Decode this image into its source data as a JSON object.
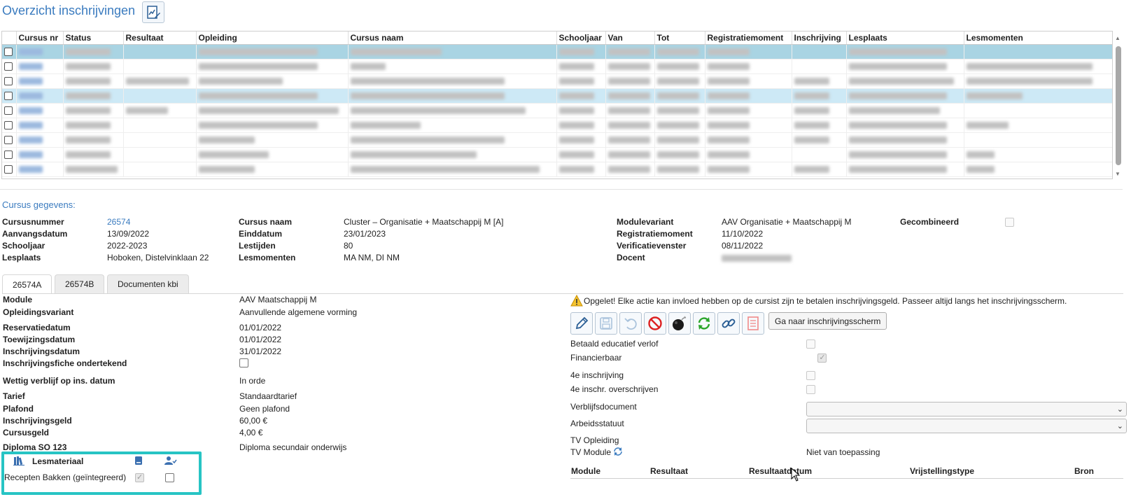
{
  "page": {
    "title": "Overzicht inschrijvingen"
  },
  "grid": {
    "columns": [
      "",
      "Cursus nr",
      "Status",
      "Resultaat",
      "Opleiding",
      "Cursus naam",
      "Schooljaar",
      "Van",
      "Tot",
      "Registratiemoment",
      "Inschrijving",
      "Lesplaats",
      "Lesmomenten"
    ]
  },
  "cursus": {
    "section_title": "Cursus gegevens:",
    "fields": {
      "cursusnummer": {
        "label": "Cursusnummer",
        "value": "26574"
      },
      "aanvangsdatum": {
        "label": "Aanvangsdatum",
        "value": "13/09/2022"
      },
      "schooljaar": {
        "label": "Schooljaar",
        "value": "2022-2023"
      },
      "lesplaats": {
        "label": "Lesplaats",
        "value": "Hoboken, Distelvinklaan 22"
      },
      "cursus_naam": {
        "label": "Cursus naam",
        "value": "Cluster – Organisatie + Maatschappij M [A]"
      },
      "einddatum": {
        "label": "Einddatum",
        "value": "23/01/2023"
      },
      "lestijden": {
        "label": "Lestijden",
        "value": "80"
      },
      "lesmomenten": {
        "label": "Lesmomenten",
        "value": "MA NM, DI NM"
      },
      "modulevariant": {
        "label": "Modulevariant",
        "value": "AAV Organisatie + Maatschappij M"
      },
      "registratiemoment": {
        "label": "Registratiemoment",
        "value": "11/10/2022"
      },
      "verificatievenster": {
        "label": "Verificatievenster",
        "value": "08/11/2022"
      },
      "docent": {
        "label": "Docent"
      },
      "gecombineerd": {
        "label": "Gecombineerd"
      }
    }
  },
  "tabs": [
    {
      "label": "26574A"
    },
    {
      "label": "26574B"
    },
    {
      "label": "Documenten kbi"
    }
  ],
  "details": {
    "module": {
      "label": "Module",
      "value": "AAV Maatschappij M"
    },
    "opleidingsvariant": {
      "label": "Opleidingsvariant",
      "value": "Aanvullende algemene vorming"
    },
    "reservatiedatum": {
      "label": "Reservatiedatum",
      "value": "01/01/2022"
    },
    "toewijzingsdatum": {
      "label": "Toewijzingsdatum",
      "value": "01/01/2022"
    },
    "inschrijvingsdatum": {
      "label": "Inschrijvingsdatum",
      "value": "31/01/2022"
    },
    "fiche": {
      "label": "Inschrijvingsfiche ondertekend"
    },
    "verblijf": {
      "label": "Wettig verblijf op ins. datum",
      "value": "In orde"
    },
    "tarief": {
      "label": "Tarief",
      "value": "Standaardtarief"
    },
    "plafond": {
      "label": "Plafond",
      "value": "Geen plafond"
    },
    "inschrijvingsgeld": {
      "label": "Inschrijvingsgeld",
      "value": "60,00 €"
    },
    "cursusgeld": {
      "label": "Cursusgeld",
      "value": "4,00 €"
    },
    "diploma": {
      "label": "Diploma SO 123",
      "value": "Diploma secundair onderwijs"
    }
  },
  "lesmateriaal": {
    "header": "Lesmateriaal",
    "item": "Recepten Bakken (geïntegreerd)"
  },
  "right": {
    "warning": "Opgelet! Elke actie kan invloed hebben op de cursist zijn te betalen inschrijvingsgeld. Passeer altijd langs het inschrijvingsscherm.",
    "goto_button": "Ga naar inschrijvingsscherm",
    "betaald": "Betaald educatief verlof",
    "financierbaar": "Financierbaar",
    "vierde": "4e inschrijving",
    "vierde_over": "4e inschr. overschrijven",
    "verblijfsdocument": "Verblijfsdocument",
    "arbeidsstatuut": "Arbeidsstatuut",
    "tv_opleiding": "TV Opleiding",
    "tv_module": "TV Module",
    "tv_module_value": "Niet van toepassing",
    "results_columns": [
      "Module",
      "Resultaat",
      "Resultaatdatum",
      "Vrijstellingstype",
      "Bron"
    ]
  },
  "icons": {
    "edit": "pencil-icon",
    "save": "floppy-icon",
    "undo": "undo-icon",
    "cancel": "ban-icon",
    "bomb": "bomb-icon",
    "refresh": "refresh-icon",
    "link": "link-icon",
    "doc": "document-icon"
  },
  "colors": {
    "accent": "#3a7bbf",
    "row_selected": "#a9d4e3",
    "row_highlight": "#cde9f6",
    "highlight_box": "#27c4c4"
  }
}
